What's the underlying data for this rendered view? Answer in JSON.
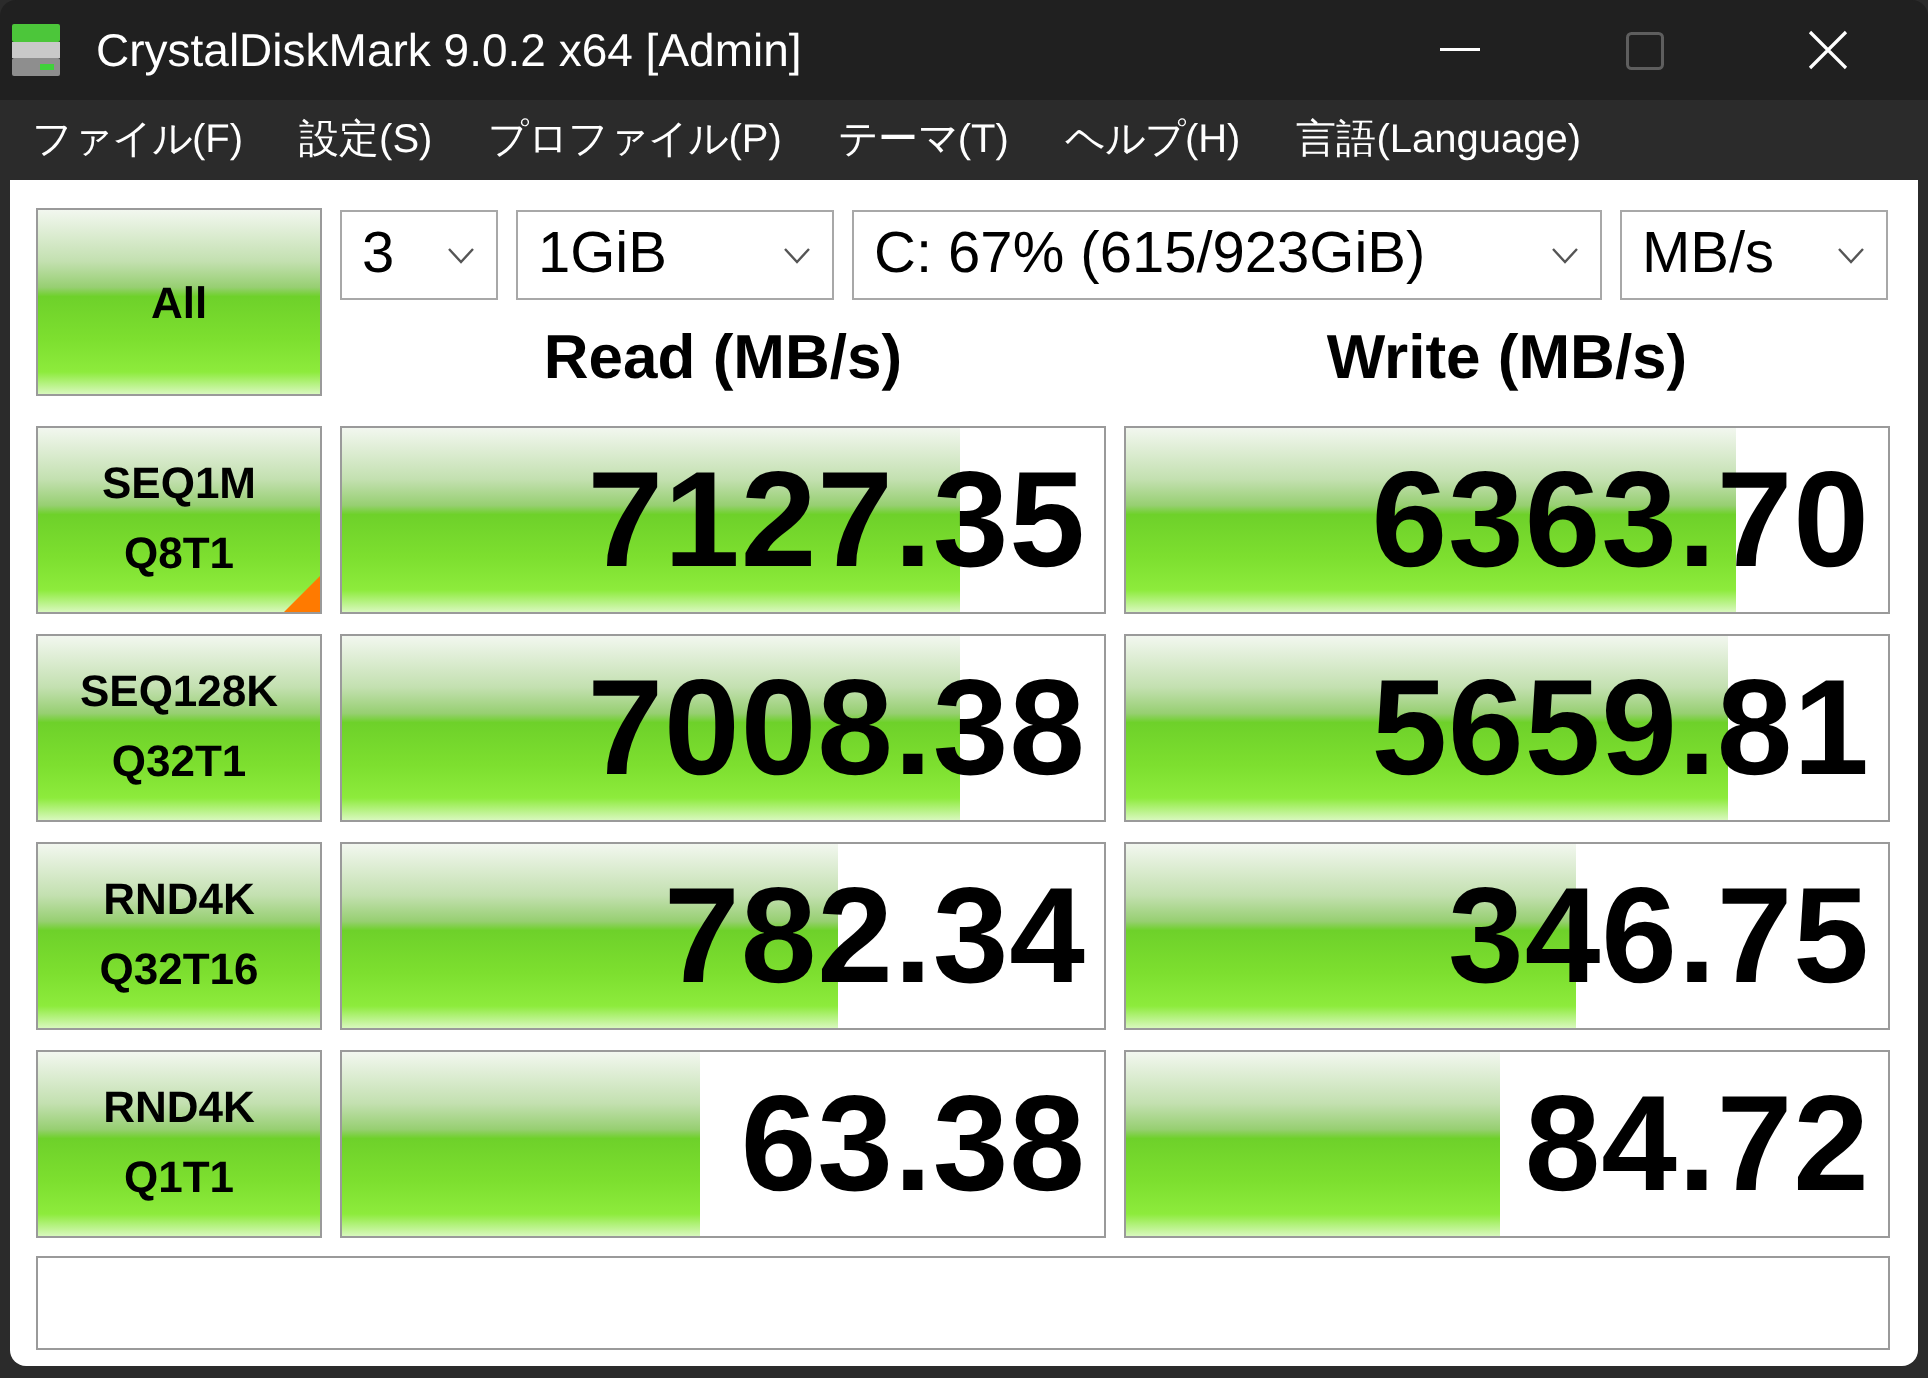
{
  "window": {
    "title": "CrystalDiskMark 9.0.2 x64 [Admin]",
    "maximize_disabled": true
  },
  "menu": [
    "ファイル(F)",
    "設定(S)",
    "プロファイル(P)",
    "テーマ(T)",
    "ヘルプ(H)",
    "言語(Language)"
  ],
  "all_button": "All",
  "selectors": [
    {
      "value": "3"
    },
    {
      "value": "1GiB"
    },
    {
      "value": "C: 67% (615/923GiB)"
    },
    {
      "value": "MB/s"
    }
  ],
  "headers": {
    "read": "Read (MB/s)",
    "write": "Write (MB/s)"
  },
  "tests": [
    {
      "name": "SEQ1M",
      "params": "Q8T1",
      "corner_mark": true,
      "read": {
        "value": "7127.35",
        "level": 0.81
      },
      "write": {
        "value": "6363.70",
        "level": 0.8
      }
    },
    {
      "name": "SEQ128K",
      "params": "Q32T1",
      "corner_mark": false,
      "read": {
        "value": "7008.38",
        "level": 0.81
      },
      "write": {
        "value": "5659.81",
        "level": 0.79
      }
    },
    {
      "name": "RND4K",
      "params": "Q32T16",
      "corner_mark": false,
      "read": {
        "value": "782.34",
        "level": 0.65
      },
      "write": {
        "value": "346.75",
        "level": 0.59
      }
    },
    {
      "name": "RND4K",
      "params": "Q1T1",
      "corner_mark": false,
      "read": {
        "value": "63.38",
        "level": 0.47
      },
      "write": {
        "value": "84.72",
        "level": 0.49
      }
    }
  ]
}
